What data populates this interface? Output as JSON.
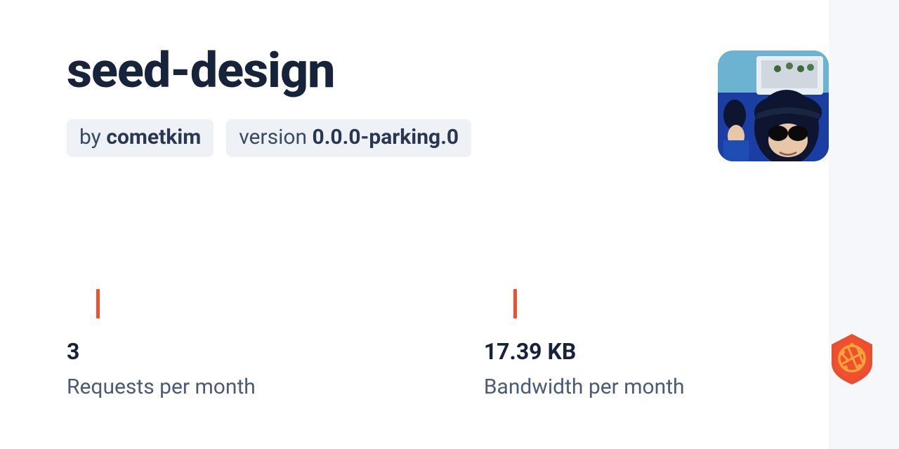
{
  "header": {
    "title": "seed-design",
    "by_prefix": "by ",
    "author": "cometkim",
    "version_prefix": "version ",
    "version": "0.0.0-parking.0"
  },
  "stats": {
    "requests": {
      "value": "3",
      "label": "Requests per month"
    },
    "bandwidth": {
      "value": "17.39 KB",
      "label": "Bandwidth per month"
    }
  }
}
